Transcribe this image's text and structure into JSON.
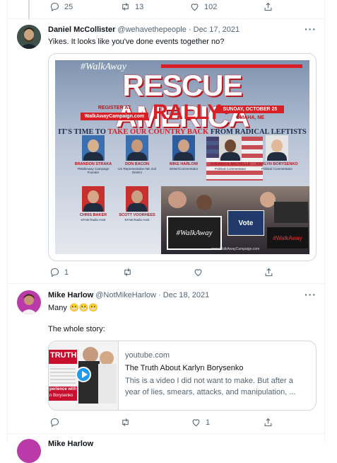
{
  "top_actions": {
    "replies": "25",
    "retweets": "13",
    "likes": "102"
  },
  "tweet1": {
    "name": "Daniel McCollister",
    "handle": "@wehavethepeople",
    "date": "Dec 17, 2021",
    "text": "Yikes. It looks like you've done events together no?",
    "actions": {
      "replies": "1",
      "retweets": "",
      "likes": ""
    },
    "poster": {
      "brand": "#WalkAway",
      "headline": "RESCUE AMERICA",
      "register_label": "REGISTER AT",
      "register_url": "WalkAwayCampaign.com",
      "rally": "RALLY",
      "date": "SUNDAY, OCTOBER 25",
      "city": "OMAHA, NE",
      "tagline_a": "IT'S TIME TO",
      "tagline_b": "TAKE OUR COUNTRY BACK",
      "tagline_c": "FROM RADICAL LEFTISTS",
      "speakers": [
        {
          "name": "BRANDON STRAKA",
          "role": "#WalkAway Campaign Founder"
        },
        {
          "name": "DON BACON",
          "role": "US Representative NE 2nd District"
        },
        {
          "name": "MIKE HARLOW",
          "role": "Writer/Commentator"
        },
        {
          "name": "SHEMEKA MICHELLE",
          "role": "Political Commentator"
        },
        {
          "name": "KARLYN BORYSENKO",
          "role": "Political Commentator"
        },
        {
          "name": "CHRIS BAKER",
          "role": "KFAB Radio Host"
        },
        {
          "name": "SCOTT VOORHEES",
          "role": "KFAB Radio Host"
        }
      ],
      "sign1": "#WalkAway",
      "sign2": "Vote",
      "sign3": "#WalkAway",
      "footer": "www.WalkAwayCampaign.com"
    }
  },
  "tweet2": {
    "name": "Mike Harlow",
    "handle": "@NotMikeHarlow",
    "date": "Dec 18, 2021",
    "line1": "Many 😬😬😬",
    "line2": "The whole story:",
    "card": {
      "domain": "youtube.com",
      "title": "The Truth About Karlyn Borysenko",
      "desc1": "This is a video I did not want to make. But after a",
      "desc2": "year of lies, smears, attacks, and manipulation, ...",
      "thumb_top": "TRUTH",
      "thumb_bottom1": "perience with",
      "thumb_bottom2": "n Borysenko"
    },
    "actions": {
      "replies": "",
      "retweets": "",
      "likes": "1"
    }
  },
  "next_tweet_partial": {
    "name": "Mike Harlow"
  }
}
